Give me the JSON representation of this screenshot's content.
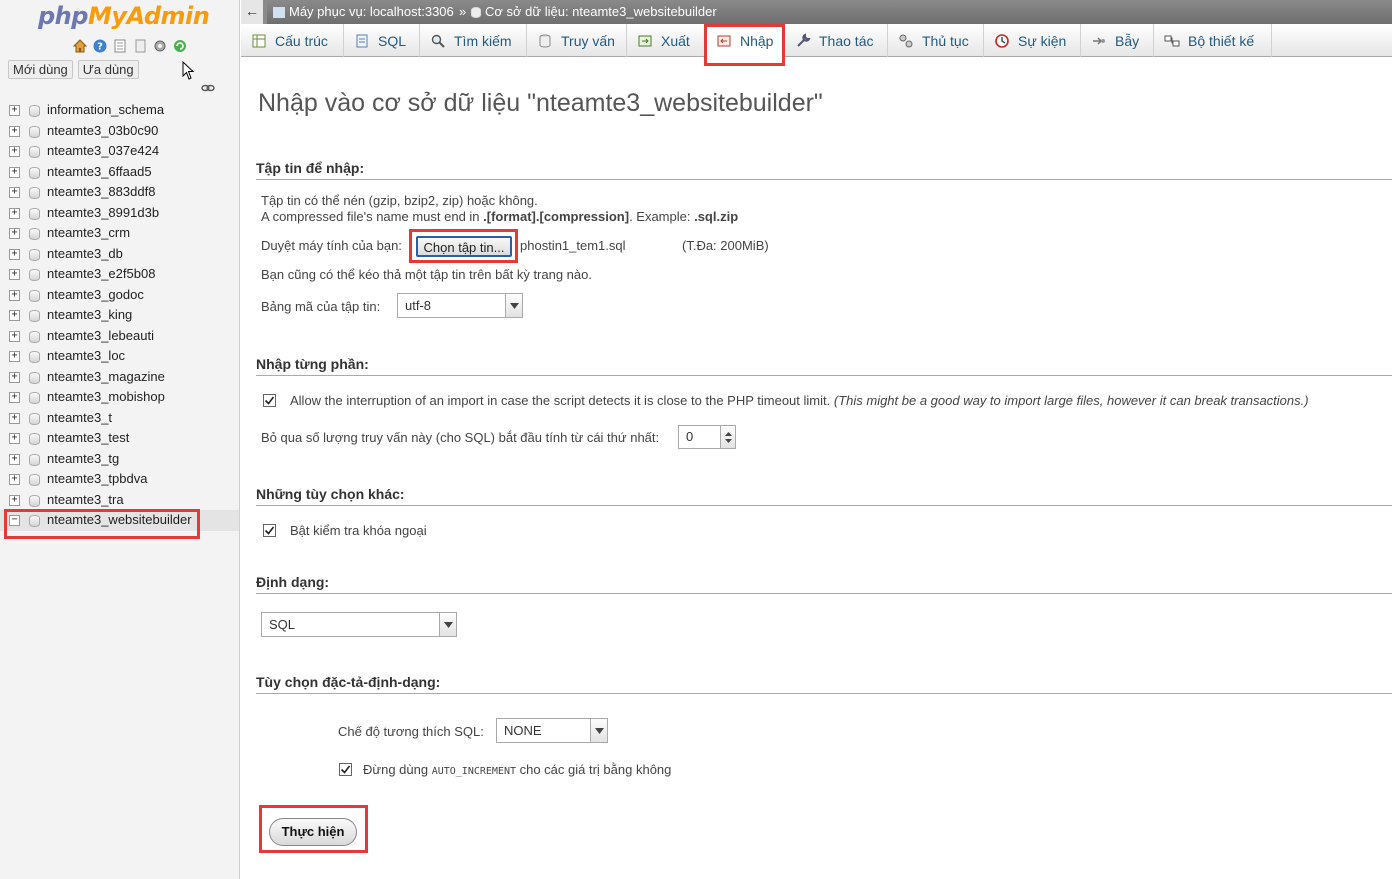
{
  "app": {
    "logo_left": "php",
    "logo_right": "MyAdmin"
  },
  "nav": {
    "tabs": [
      "Mới dùng",
      "Ưa dùng"
    ],
    "icons": [
      "home-icon",
      "help-icon",
      "docs-icon",
      "settings-icon",
      "reload-icon"
    ],
    "databases": [
      "information_schema",
      "nteamte3_03b0c90",
      "nteamte3_037e424",
      "nteamte3_6ffaad5",
      "nteamte3_883ddf8",
      "nteamte3_8991d3b",
      "nteamte3_crm",
      "nteamte3_db",
      "nteamte3_e2f5b08",
      "nteamte3_godoc",
      "nteamte3_king",
      "nteamte3_lebeauti",
      "nteamte3_loc",
      "nteamte3_magazine",
      "nteamte3_mobishop",
      "nteamte3_t",
      "nteamte3_test",
      "nteamte3_tg",
      "nteamte3_tpbdva",
      "nteamte3_tra",
      "nteamte3_websitebuilder"
    ],
    "selected_index": 20
  },
  "breadcrumb": {
    "server": "Máy phục vụ: localhost:3306",
    "separator": "»",
    "database": "Cơ sở dữ liệu: nteamte3_websitebuilder"
  },
  "tabs": [
    {
      "label": "Cấu trúc",
      "icon": "structure-icon"
    },
    {
      "label": "SQL",
      "icon": "sql-icon"
    },
    {
      "label": "Tìm kiếm",
      "icon": "search-icon"
    },
    {
      "label": "Truy vấn",
      "icon": "query-icon"
    },
    {
      "label": "Xuất",
      "icon": "export-icon"
    },
    {
      "label": "Nhập",
      "icon": "import-icon"
    },
    {
      "label": "Thao tác",
      "icon": "wrench-icon"
    },
    {
      "label": "Thủ tục",
      "icon": "routines-icon"
    },
    {
      "label": "Sự kiện",
      "icon": "events-icon"
    },
    {
      "label": "Bẫy",
      "icon": "triggers-icon"
    },
    {
      "label": "Bộ thiết kế",
      "icon": "designer-icon"
    }
  ],
  "active_tab": "Nhập",
  "main": {
    "title": "Nhập vào cơ sở dữ liệu \"nteamte3_websitebuilder\"",
    "file_section": {
      "title": "Tập tin để nhập:",
      "note1": "Tập tin có thể nén (gzip, bzip2, zip) hoặc không.",
      "note2_prefix": "A compressed file's name must end in ",
      "note2_bold": ".[format].[compression]",
      "note2_mid": ". Example: ",
      "note2_example": ".sql.zip",
      "browse_label": "Duyệt máy tính của bạn:",
      "choose_button": "Chọn tập tin...",
      "file_name": "phostin1_tem1.sql",
      "max_size": "(T.Đa: 200MiB)",
      "drag_note": "Bạn cũng có thể kéo thả một tập tin trên bất kỳ trang nào.",
      "charset_label": "Bảng mã của tập tin:",
      "charset_value": "utf-8"
    },
    "partial_section": {
      "title": "Nhập từng phần:",
      "allow_interrupt_label": "Allow the interruption of an import in case the script detects it is close to the PHP timeout limit.",
      "allow_interrupt_note": "(This might be a good way to import large files, however it can break transactions.)",
      "allow_interrupt_checked": true,
      "skip_label": "Bỏ qua số lượng truy vấn này (cho SQL) bắt đầu tính từ cái thứ nhất:",
      "skip_value": "0"
    },
    "other_section": {
      "title": "Những tùy chọn khác:",
      "fk_label": "Bật kiểm tra khóa ngoại",
      "fk_checked": true
    },
    "format_section": {
      "title": "Định dạng:",
      "format_value": "SQL"
    },
    "format_options_section": {
      "title": "Tùy chọn đặc-tả-định-dạng:",
      "compat_label": "Chế độ tương thích SQL:",
      "compat_value": "NONE",
      "autoinc_prefix": "Đừng dùng ",
      "autoinc_code": "AUTO_INCREMENT",
      "autoinc_suffix": " cho các giá trị bằng không",
      "autoinc_checked": true
    },
    "go_button": "Thực hiện"
  },
  "colors": {
    "highlight": "#e53935",
    "link": "#235a81",
    "logo_php": "#6c78af",
    "logo_admin": "#f89c0e"
  }
}
